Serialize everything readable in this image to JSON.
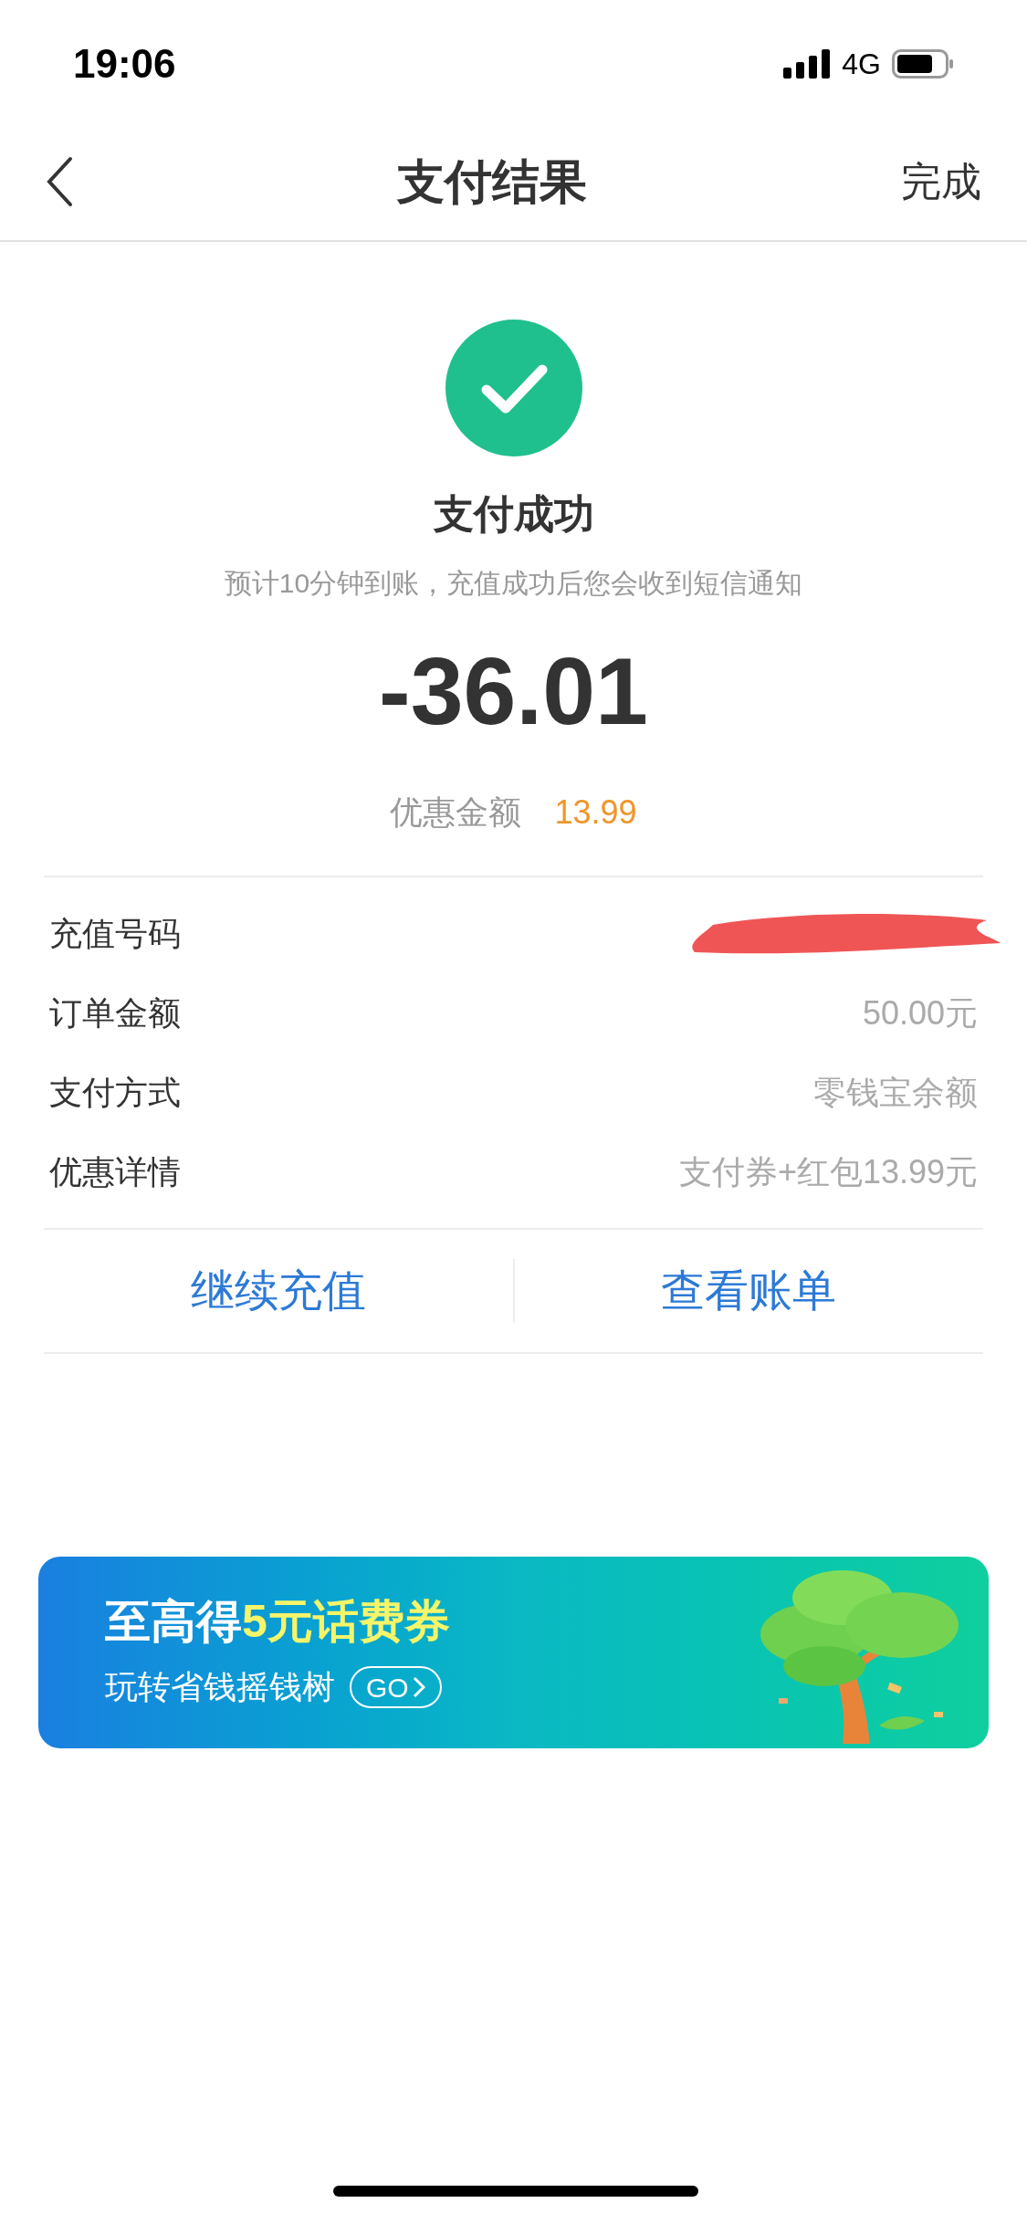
{
  "status_bar": {
    "time": "19:06",
    "network": "4G"
  },
  "header": {
    "title": "支付结果",
    "done": "完成"
  },
  "result": {
    "title": "支付成功",
    "note": "预计10分钟到账，充值成功后您会收到短信通知",
    "amount": "-36.01",
    "discount_label": "优惠金额",
    "discount_value": "13.99"
  },
  "details": [
    {
      "label": "充值号码",
      "kind": "redacted"
    },
    {
      "label": "订单金额",
      "value": "50.00元",
      "kind": "text"
    },
    {
      "label": "支付方式",
      "value": "零钱宝余额",
      "kind": "text"
    },
    {
      "label": "优惠详情",
      "value": "支付券+红包13.99元",
      "kind": "text"
    }
  ],
  "actions": [
    "继续充值",
    "查看账单"
  ],
  "banner": {
    "headline_lead": "至高得",
    "headline_highlight": "5元话费券",
    "subline": "玩转省钱摇钱树",
    "go": "GO"
  }
}
